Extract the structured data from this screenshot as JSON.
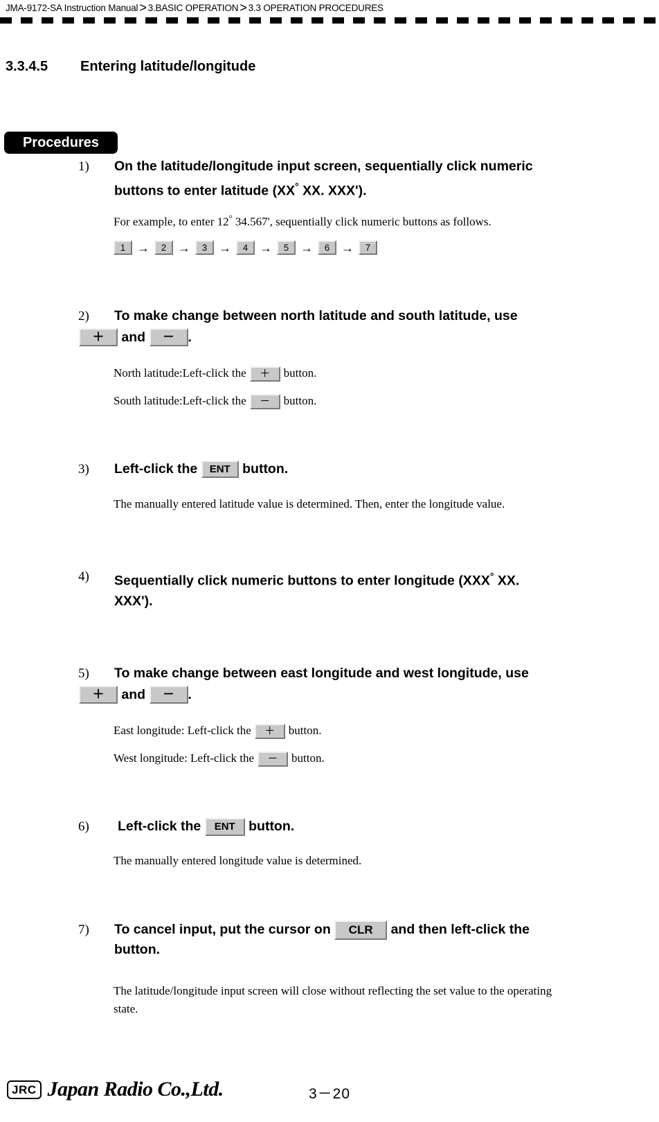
{
  "header": {
    "manual": "JMA-9172-SA Instruction Manual",
    "separator": ">",
    "chapter": "3.BASIC OPERATION",
    "section": "3.3  OPERATION PROCEDURES"
  },
  "section": {
    "number": "3.3.4.5",
    "title": "Entering latitude/longitude"
  },
  "procedures_badge": "Procedures",
  "steps": [
    {
      "marker": "1)",
      "heading_line1": "On the latitude/longitude input screen, sequentially click numeric",
      "heading_line2_a": "buttons to enter latitude (XX",
      "heading_line2_deg": "°",
      "heading_line2_b": " XX",
      "heading_line2_c": ". XXX').",
      "example_a": "For example, to enter 12",
      "example_deg": "°",
      "example_b": "  34.567', sequentially click numeric buttons as follows.",
      "sequence": [
        "1",
        "2",
        "3",
        "4",
        "5",
        "6",
        "7"
      ],
      "sequence_arrow": "→"
    },
    {
      "marker": "2)",
      "heading_line1": "To make change between north latitude and south latitude, use",
      "key_plus": "＋",
      "conjunction": "and",
      "key_minus": "－",
      "period": ".",
      "note1_pre": "North latitude:Left-click the",
      "note1_key": "＋",
      "note1_post": "button.",
      "note2_pre": "South latitude:Left-click the",
      "note2_key": "－",
      "note2_post": "button."
    },
    {
      "marker": "3)",
      "heading_pre": "Left-click the",
      "heading_key": "ENT",
      "heading_post": "button.",
      "body": "The manually entered latitude value is determined. Then, enter the longitude value."
    },
    {
      "marker": "4)",
      "heading_line1_a": "Sequentially click numeric buttons to enter longitude (XXX",
      "heading_line1_deg": "°",
      "heading_line1_b": " XX",
      "heading_line1_c": ".",
      "heading_line2": "XXX')."
    },
    {
      "marker": "5)",
      "heading_line1": "To make change between east longitude and west longitude, use",
      "key_plus": "＋",
      "conjunction": "and",
      "key_minus": "－",
      "period": ".",
      "note1_pre": "East longitude: Left-click the",
      "note1_key": "＋",
      "note1_post": "button.",
      "note2_pre": "West longitude: Left-click the",
      "note2_key": "－",
      "note2_post": "button."
    },
    {
      "marker": "6)",
      "heading_pre": "Left-click the",
      "heading_key": "ENT",
      "heading_post": "button.",
      "body": "The manually entered longitude value is determined."
    },
    {
      "marker": "7)",
      "heading_pre": "To cancel input, put the cursor on",
      "heading_key": "CLR",
      "heading_post": "and then left-click the",
      "heading_line2": "button.",
      "body_line1": "The latitude/longitude input screen will close without reflecting the set value to the operating",
      "body_line2": "state."
    }
  ],
  "footer": {
    "logo_mark": "JRC",
    "company": "Japan Radio Co.,Ltd.",
    "page": "3－20"
  }
}
